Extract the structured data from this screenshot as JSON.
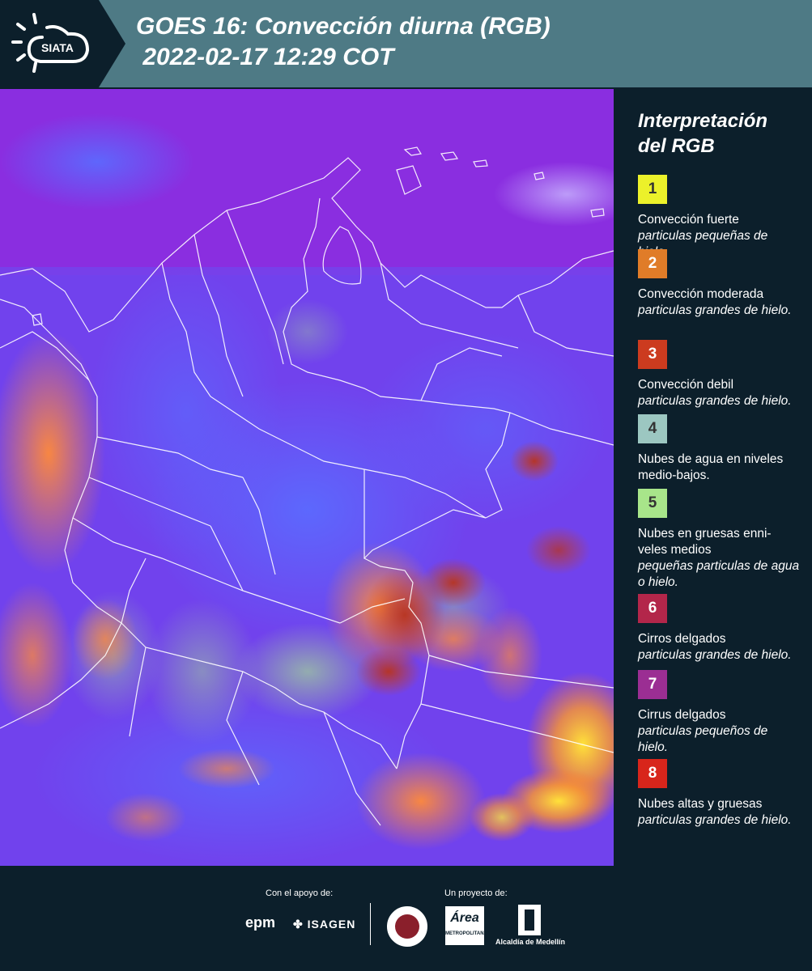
{
  "header": {
    "logo_text": "SIATA",
    "title_line1": "GOES 16: Convección diurna (RGB)",
    "title_line2": " 2022-02-17 12:29 COT"
  },
  "legend": {
    "title_line1": "Interpretación",
    "title_line2": "del RGB",
    "items": [
      {
        "num": "1",
        "color": "#ecf12a",
        "text_color": "#333333",
        "label": "Convección fuerte",
        "sub": "particulas pequeñas de hielo."
      },
      {
        "num": "2",
        "color": "#e07c28",
        "text_color": "#ffffff",
        "label": "Convección moderada",
        "sub": "particulas grandes de hielo."
      },
      {
        "num": "3",
        "color": "#cc3b1f",
        "text_color": "#ffffff",
        "label": "Convección debil",
        "sub": "particulas grandes de hielo."
      },
      {
        "num": "4",
        "color": "#9cc7c1",
        "text_color": "#333333",
        "label": "Nubes de agua en niveles medio-bajos.",
        "sub": ""
      },
      {
        "num": "5",
        "color": "#a8e58a",
        "text_color": "#333333",
        "label": "Nubes en gruesas enni-veles medios",
        "sub": "pequeñas particulas de agua o hielo."
      },
      {
        "num": "6",
        "color": "#b3264a",
        "text_color": "#ffffff",
        "label": "Cirros delgados",
        "sub": "particulas grandes de hielo."
      },
      {
        "num": "7",
        "color": "#9b2e93",
        "text_color": "#ffffff",
        "label": "Cirrus delgados",
        "sub": "particulas pequeños de hielo."
      },
      {
        "num": "8",
        "color": "#d8251b",
        "text_color": "#ffffff",
        "label": "Nubes altas y gruesas",
        "sub": "particulas grandes de hielo."
      }
    ]
  },
  "footer": {
    "support_label": "Con el apoyo de:",
    "project_label": "Un proyecto de:",
    "epm": "epm",
    "isagen": "ISAGEN",
    "area_logo": "Área",
    "area_sub": "METROPOLITANA",
    "alcaldia": "Alcaldía de Medellín"
  }
}
